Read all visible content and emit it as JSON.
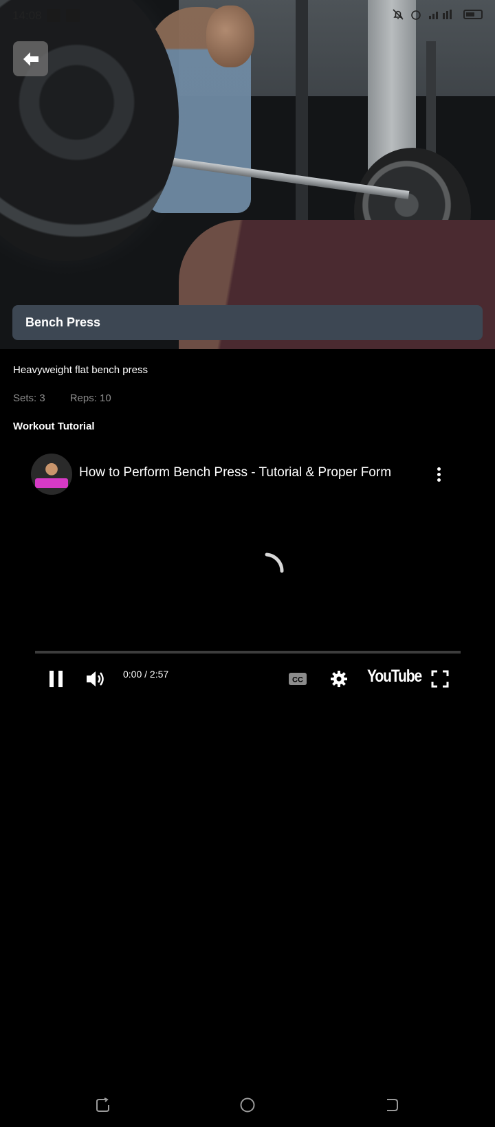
{
  "status_bar": {
    "time": "14:08"
  },
  "exercise": {
    "title": "Bench Press",
    "description": "Heavyweight flat bench press",
    "sets_label": "Sets: 3",
    "reps_label": "Reps: 10"
  },
  "section": {
    "title": "Workout Tutorial"
  },
  "video": {
    "title": "How to Perform Bench Press - Tutorial & Proper Form",
    "time_display": "0:00 / 2:57",
    "brand": "YouTube",
    "progress": 0
  },
  "icons": {
    "back": "arrow-left-icon",
    "more": "more-vertical-icon",
    "pause": "pause-icon",
    "volume": "volume-icon",
    "captions": "cc-icon",
    "settings": "gear-icon",
    "fullscreen": "fullscreen-icon",
    "nav_recent": "recent-apps-icon",
    "nav_home": "home-icon",
    "nav_back": "back-icon"
  },
  "colors": {
    "title_card_bg": "#3d4753",
    "stats_text": "#8b8b8b",
    "background": "#000000"
  }
}
